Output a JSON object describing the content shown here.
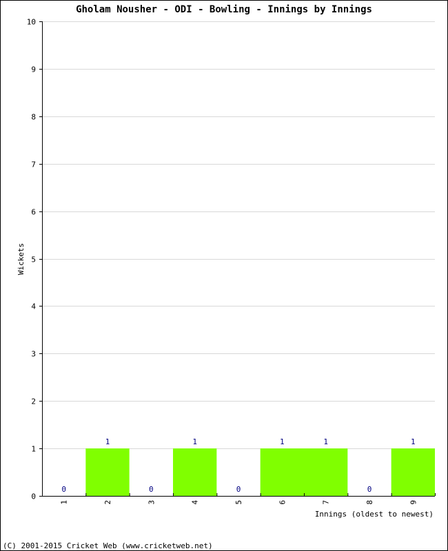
{
  "chart_data": {
    "type": "bar",
    "title": "Gholam Nousher - ODI - Bowling - Innings by Innings",
    "xlabel": "Innings (oldest to newest)",
    "ylabel": "Wickets",
    "categories": [
      "1",
      "2",
      "3",
      "4",
      "5",
      "6",
      "7",
      "8",
      "9"
    ],
    "values": [
      0,
      1,
      0,
      1,
      0,
      1,
      1,
      0,
      1
    ],
    "ylim": [
      0,
      10
    ],
    "yticks": [
      0,
      1,
      2,
      3,
      4,
      5,
      6,
      7,
      8,
      9,
      10
    ],
    "grid": true,
    "bar_color": "#80ff00",
    "label_color": "#000080"
  },
  "footer": "(C) 2001-2015 Cricket Web (www.cricketweb.net)"
}
